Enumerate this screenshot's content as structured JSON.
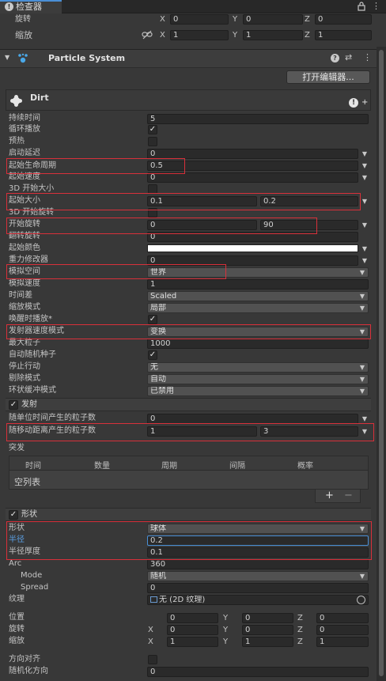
{
  "tab": {
    "title": "检查器",
    "info_icon": "info-icon",
    "lock_icon": "lock-icon",
    "menu_icon": "kebab-icon"
  },
  "transform": {
    "rotation": {
      "label": "旋转",
      "x": "0",
      "y": "0",
      "z": "0"
    },
    "scale": {
      "label": "缩放",
      "link_icon": "link-icon",
      "x": "1",
      "y": "1",
      "z": "1"
    },
    "axis_x": "X",
    "axis_y": "Y",
    "axis_z": "Z"
  },
  "component": {
    "title": "Particle System",
    "open_editor_label": "打开编辑器..."
  },
  "system_name": "Dirt",
  "main": {
    "duration": {
      "label": "持续时间",
      "value": "5"
    },
    "looping": {
      "label": "循环播放"
    },
    "prewarm": {
      "label": "预热"
    },
    "start_delay": {
      "label": "启动延迟",
      "value": "0"
    },
    "start_lifetime": {
      "label": "起始生命周期",
      "value": "0.5"
    },
    "start_speed": {
      "label": "起始速度",
      "value": "0"
    },
    "start_size_3d": {
      "label": "3D 开始大小"
    },
    "start_size": {
      "label": "起始大小",
      "min": "0.1",
      "max": "0.2"
    },
    "start_rotation_3d": {
      "label": "3D 开始旋转"
    },
    "start_rotation": {
      "label": "开始旋转",
      "min": "0",
      "max": "90"
    },
    "flip_rotation": {
      "label": "翻转旋转",
      "value": "0"
    },
    "start_color": {
      "label": "起始颜色",
      "color": "#ffffff"
    },
    "gravity": {
      "label": "重力修改器",
      "value": "0"
    },
    "sim_space": {
      "label": "模拟空间",
      "value": "世界"
    },
    "sim_speed": {
      "label": "模拟速度",
      "value": "1"
    },
    "delta_time": {
      "label": "时间差",
      "value": "Scaled"
    },
    "scaling_mode": {
      "label": "缩放模式",
      "value": "局部"
    },
    "play_on_awake": {
      "label": "唤醒时播放*"
    },
    "emitter_velocity": {
      "label": "发射器速度模式",
      "value": "变换"
    },
    "max_particles": {
      "label": "最大粒子",
      "value": "1000"
    },
    "auto_random_seed": {
      "label": "自动随机种子"
    },
    "stop_action": {
      "label": "停止行动",
      "value": "无"
    },
    "culling_mode": {
      "label": "剔除模式",
      "value": "自动"
    },
    "ring_buffer": {
      "label": "环状缓冲模式",
      "value": "已禁用"
    }
  },
  "emission": {
    "header": "发射",
    "rate_over_time": {
      "label": "随单位时间产生的粒子数",
      "value": "0"
    },
    "rate_over_distance": {
      "label": "随移动距离产生的粒子数",
      "min": "1",
      "max": "3"
    },
    "bursts_label": "突发",
    "bursts_columns": [
      "时间",
      "数量",
      "周期",
      "间隔",
      "概率"
    ],
    "empty_list": "空列表",
    "add_label": "+",
    "remove_label": "−"
  },
  "shape": {
    "header": "形状",
    "shape": {
      "label": "形状",
      "value": "球体"
    },
    "radius": {
      "label": "半径",
      "value": "0.2"
    },
    "radius_thickness": {
      "label": "半径厚度",
      "value": "0.1"
    },
    "arc": {
      "label": "Arc",
      "value": "360"
    },
    "mode": {
      "label": "Mode",
      "value": "随机"
    },
    "spread": {
      "label": "Spread",
      "value": "0"
    },
    "texture": {
      "label": "纹理",
      "value": "无 (2D 纹理)"
    },
    "position": {
      "label": "位置",
      "x": "0",
      "y": "0",
      "z": "0"
    },
    "rotation": {
      "label": "旋转",
      "x": "0",
      "y": "0",
      "z": "0"
    },
    "scale": {
      "label": "缩放",
      "x": "1",
      "y": "1",
      "z": "1"
    },
    "align_to_direction": {
      "label": "方向对齐"
    },
    "randomize_direction": {
      "label": "随机化方向",
      "value": "0"
    }
  },
  "colors": {
    "highlight": "#d8303a",
    "accent_blue": "#4a8fd6",
    "panel_bg": "#383838"
  }
}
